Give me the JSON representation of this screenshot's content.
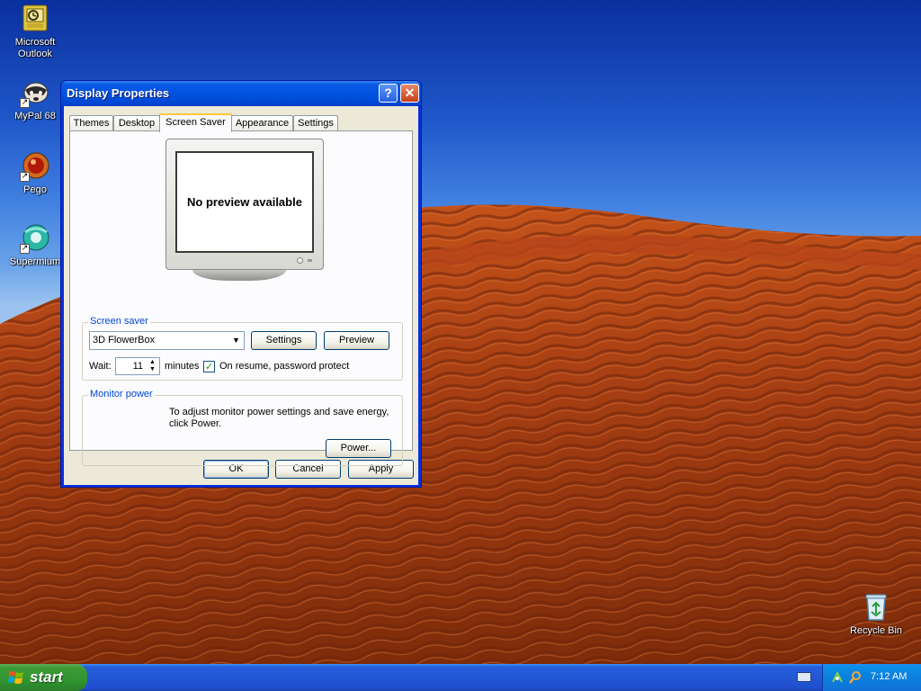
{
  "desktop": {
    "icons": [
      {
        "label_line1": "Microsoft",
        "label_line2": "Outlook",
        "icon": "outlook-icon"
      },
      {
        "label_line1": "MyPal 68",
        "label_line2": "",
        "icon": "mypal-icon"
      },
      {
        "label_line1": "Pego",
        "label_line2": "",
        "icon": "pego-icon"
      },
      {
        "label_line1": "Supermium",
        "label_line2": "",
        "icon": "supermium-icon"
      },
      {
        "label_line1": "Recycle Bin",
        "label_line2": "",
        "icon": "recycle-bin-icon"
      }
    ]
  },
  "window": {
    "title": "Display Properties",
    "help_glyph": "?",
    "close_glyph": "✕",
    "tabs": [
      "Themes",
      "Desktop",
      "Screen Saver",
      "Appearance",
      "Settings"
    ],
    "active_tab": "Screen Saver",
    "preview_text": "No preview available",
    "screen_saver": {
      "group_title": "Screen saver",
      "selected": "3D FlowerBox",
      "settings_label": "Settings",
      "preview_label": "Preview",
      "wait_label": "Wait:",
      "wait_value": "11",
      "minutes_label": "minutes",
      "password_protect_label": "On resume, password protect",
      "password_protect_checked": true
    },
    "monitor_power": {
      "group_title": "Monitor power",
      "description_line1": "To adjust monitor power settings and save energy,",
      "description_line2": "click Power.",
      "power_label": "Power..."
    },
    "buttons": {
      "ok": "OK",
      "cancel": "Cancel",
      "apply": "Apply"
    }
  },
  "taskbar": {
    "start_label": "start",
    "clock": "7:12 AM"
  },
  "colors": {
    "titlebar": "#0153e0",
    "dialog_bg": "#ece9d8",
    "group_title": "#0046d5",
    "active_tab_accent": "#ffc83c",
    "taskbar": "#245edb",
    "start": "#309530"
  }
}
